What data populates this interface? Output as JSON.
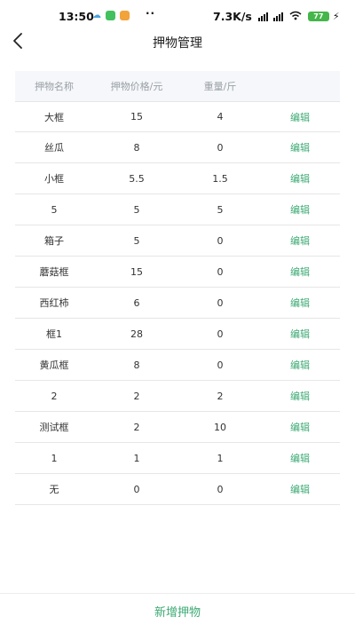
{
  "status_bar": {
    "time": "13:50",
    "dots": "··",
    "speed": "7.3K/s",
    "battery": "77",
    "icons": [
      "weather-icon",
      "wechat-icon",
      "message-icon",
      "hd-signal-icon",
      "wifi-icon",
      "battery-icon",
      "charging-icon"
    ]
  },
  "nav": {
    "title": "押物管理",
    "back_icon": "chevron-left-icon"
  },
  "table": {
    "headers": [
      "押物名称",
      "押物价格/元",
      "重量/斤",
      ""
    ],
    "rows": [
      {
        "name": "大框",
        "price": "15",
        "weight": "4",
        "action": "编辑"
      },
      {
        "name": "丝瓜",
        "price": "8",
        "weight": "0",
        "action": "编辑"
      },
      {
        "name": "小框",
        "price": "5.5",
        "weight": "1.5",
        "action": "编辑"
      },
      {
        "name": "5",
        "price": "5",
        "weight": "5",
        "action": "编辑"
      },
      {
        "name": "箱子",
        "price": "5",
        "weight": "0",
        "action": "编辑"
      },
      {
        "name": "蘑菇框",
        "price": "15",
        "weight": "0",
        "action": "编辑"
      },
      {
        "name": "西红柿",
        "price": "6",
        "weight": "0",
        "action": "编辑"
      },
      {
        "name": "框1",
        "price": "28",
        "weight": "0",
        "action": "编辑"
      },
      {
        "name": "黄瓜框",
        "price": "8",
        "weight": "0",
        "action": "编辑"
      },
      {
        "name": "2",
        "price": "2",
        "weight": "2",
        "action": "编辑"
      },
      {
        "name": "测试框",
        "price": "2",
        "weight": "10",
        "action": "编辑"
      },
      {
        "name": "1",
        "price": "1",
        "weight": "1",
        "action": "编辑"
      },
      {
        "name": "无",
        "price": "0",
        "weight": "0",
        "action": "编辑"
      }
    ]
  },
  "footer": {
    "add_label": "新增押物"
  },
  "colors": {
    "accent": "#3daa74",
    "header_bg": "#f5f7fa",
    "battery": "#45b649"
  }
}
